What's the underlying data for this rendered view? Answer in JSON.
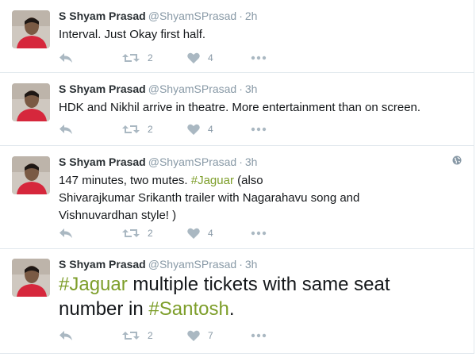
{
  "tweets": [
    {
      "name": "S Shyam Prasad",
      "handle": "@ShyamSPrasad",
      "separator": "·",
      "time": "2h",
      "text": "Interval. Just Okay first half.",
      "retweets": "2",
      "likes": "4"
    },
    {
      "name": "S Shyam Prasad",
      "handle": "@ShyamSPrasad",
      "separator": "·",
      "time": "3h",
      "text": "HDK and Nikhil arrive in theatre. More entertainment than on screen.",
      "retweets": "2",
      "likes": "4"
    },
    {
      "name": "S Shyam Prasad",
      "handle": "@ShyamSPrasad",
      "separator": "·",
      "time": "3h",
      "text_part1": "147 minutes, two mutes. ",
      "hashtag1": "#Jaguar",
      "text_part2": " (also",
      "text_line2": " Shivarajkumar Srikanth trailer with Nagarahavu song and",
      "text_line3": "Vishnuvardhan style! )",
      "retweets": "2",
      "likes": "4"
    },
    {
      "name": "S Shyam Prasad",
      "handle": "@ShyamSPrasad",
      "separator": "·",
      "time": "3h",
      "hashtag1": "#Jaguar",
      "text_part1": " multiple tickets with same seat",
      "text_part2": "number in ",
      "hashtag2": "#Santosh",
      "text_part3": ".",
      "retweets": "2",
      "likes": "7"
    }
  ],
  "colors": {
    "hashtag": "#7d9e2a",
    "muted": "#8899a6",
    "icon": "#aab8c2",
    "divider": "#e1e8ed"
  },
  "icons": {
    "reply": "reply-icon",
    "retweet": "retweet-icon",
    "like": "heart-icon",
    "more": "more-dots-icon",
    "geo": "globe-icon"
  }
}
